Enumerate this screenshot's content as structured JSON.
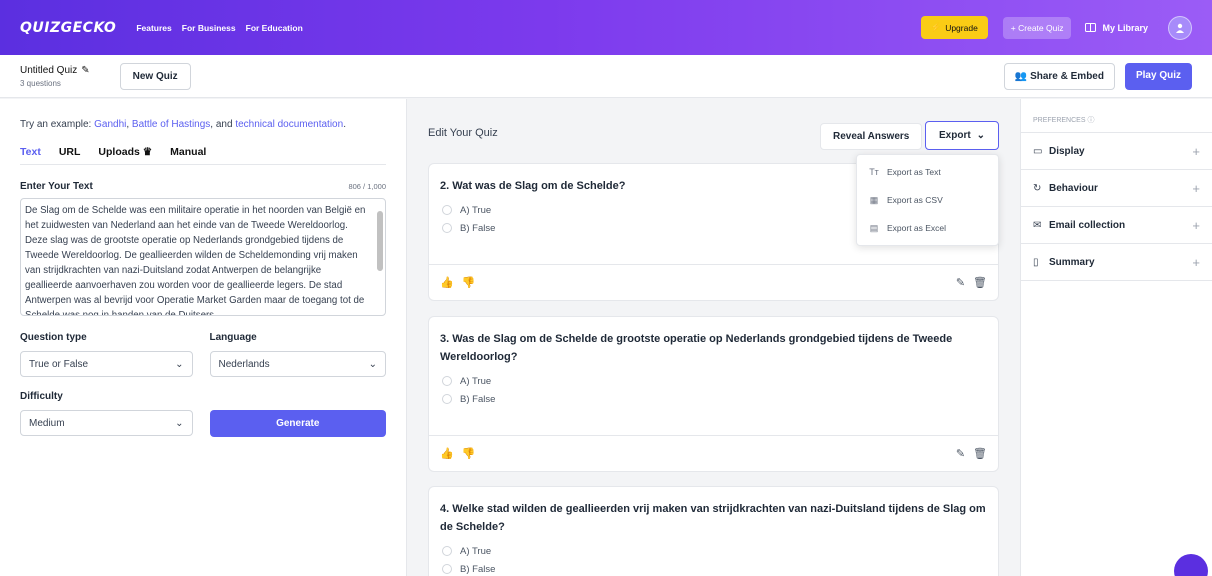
{
  "nav": {
    "logo": "QUIZGECKO",
    "links": [
      "Features",
      "For Business",
      "For Education"
    ],
    "upgrade": "Upgrade",
    "create_quiz": "+ Create Quiz",
    "my_library": "My Library"
  },
  "subheader": {
    "quiz_title": "Untitled Quiz",
    "quiz_count": "3 questions",
    "new_quiz": "New Quiz",
    "share": "Share & Embed",
    "play": "Play Quiz"
  },
  "left": {
    "examples_prefix": "Try an example: ",
    "example_1": "Gandhi",
    "sep1": ", ",
    "example_2": "Battle of Hastings",
    "sep2": ", and ",
    "example_3": "technical documentation",
    "suffix": ".",
    "tabs": [
      "Text",
      "URL",
      "Uploads",
      "Manual"
    ],
    "enter_label": "Enter Your Text",
    "counter": "806 / 1,000",
    "text": "De Slag om de Schelde was een militaire operatie in het noorden van België en het zuidwesten van Nederland aan het einde van de Tweede Wereldoorlog. Deze slag was de grootste operatie op Nederlands grondgebied tijdens de Tweede Wereldoorlog. De geallieerden wilden de Scheldemonding vrij maken van strijdkrachten van nazi-Duitsland zodat Antwerpen de belangrijke geallieerde aanvoerhaven zou worden voor de geallieerde legers. De stad Antwerpen was al bevrijd voor Operatie Market Garden maar de toegang tot de Schelde was nog in handen van de Duitsers.",
    "question_type_label": "Question type",
    "question_type": "True or False",
    "language_label": "Language",
    "language": "Nederlands",
    "difficulty_label": "Difficulty",
    "difficulty": "Medium",
    "generate": "Generate"
  },
  "center": {
    "title": "Edit Your Quiz",
    "reveal": "Reveal Answers",
    "export": "Export",
    "export_menu": [
      {
        "icon": "text-icon",
        "label": "Export as Text"
      },
      {
        "icon": "csv-icon",
        "label": "Export as CSV"
      },
      {
        "icon": "excel-icon",
        "label": "Export as Excel"
      }
    ],
    "questions": [
      {
        "text": "2. Wat was de Slag om de Schelde?",
        "options": [
          "A) True",
          "B) False"
        ]
      },
      {
        "text": "3. Was de Slag om de Schelde de grootste operatie op Nederlands grondgebied tijdens de Tweede Wereldoorlog?",
        "options": [
          "A) True",
          "B) False"
        ]
      },
      {
        "text": "4. Welke stad wilden de geallieerden vrij maken van strijdkrachten van nazi-Duitsland tijdens de Slag om de Schelde?",
        "options": [
          "A) True",
          "B) False"
        ]
      }
    ]
  },
  "right": {
    "preferences": "PREFERENCES",
    "items": [
      "Display",
      "Behaviour",
      "Email collection",
      "Summary"
    ]
  }
}
